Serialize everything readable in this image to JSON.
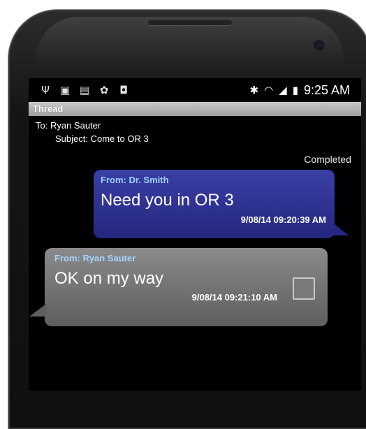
{
  "statusbar": {
    "left_icons": [
      "usb-icon",
      "gallery-icon",
      "calendar-icon",
      "android-icon",
      "shopping-bag-icon"
    ],
    "right_icons": [
      "bluetooth-icon",
      "wifi-icon",
      "signal-icon",
      "battery-icon"
    ],
    "time": "9:25 AM"
  },
  "header": {
    "title": "Thread"
  },
  "thread": {
    "to": "To: Ryan Sauter",
    "subject": "Subject: Come to OR 3",
    "status": "Completed"
  },
  "messages": [
    {
      "direction": "outgoing",
      "from": "From: Dr. Smith",
      "text": "Need you in OR 3",
      "timestamp": "9/08/14  09:20:39 AM",
      "color": "#2a2f8f"
    },
    {
      "direction": "incoming",
      "from": "From: Ryan Sauter",
      "text": "OK on my way",
      "timestamp": "9/08/14  09:21:10 AM",
      "color": "#6e6e6e",
      "checkbox_checked": false
    }
  ]
}
